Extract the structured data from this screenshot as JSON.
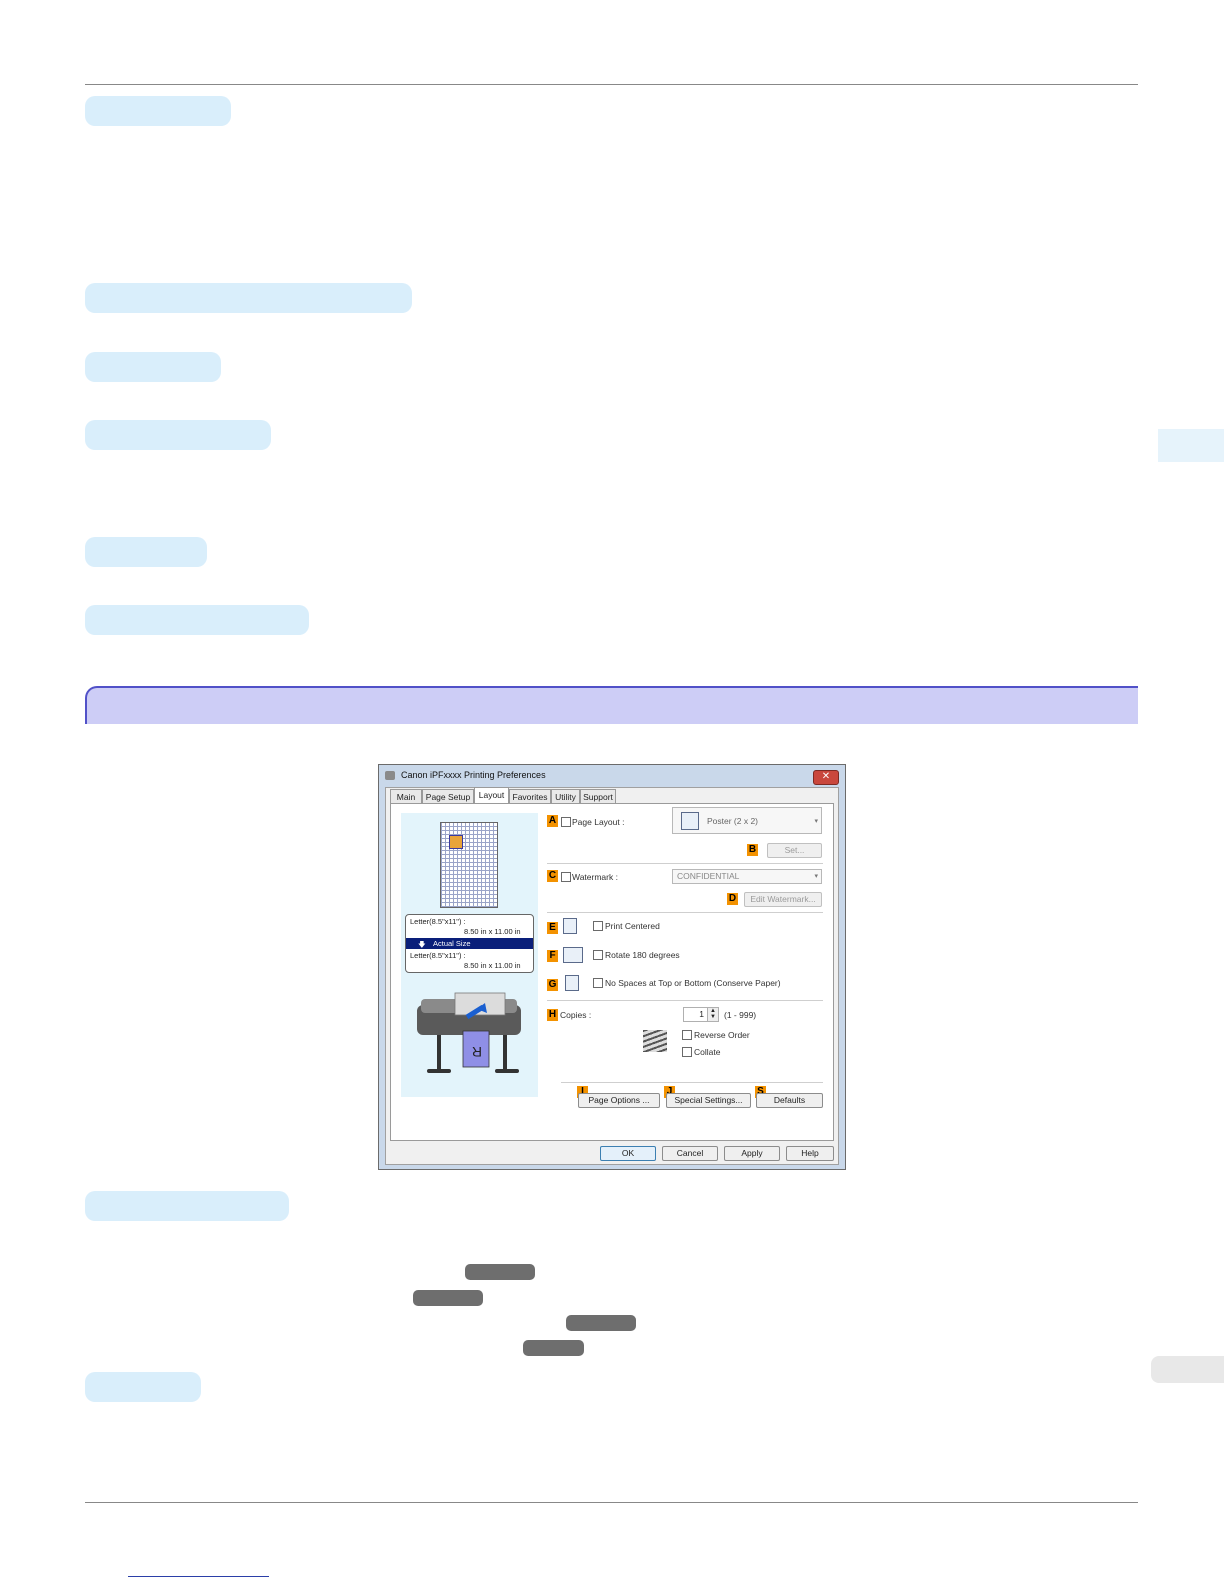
{
  "dialog": {
    "title": "Canon iPFxxxx Printing Preferences",
    "close_glyph": "✕",
    "tabs": [
      {
        "label": "Main"
      },
      {
        "label": "Page Setup"
      },
      {
        "label": "Layout"
      },
      {
        "label": "Favorites"
      },
      {
        "label": "Utility"
      },
      {
        "label": "Support"
      }
    ],
    "active_tab": "Layout",
    "preview": {
      "source_size": "Letter(8.5\"x11\") :",
      "source_dims": "8.50 in x 11.00 in",
      "mode": "Actual Size",
      "mode_arrow": "🡇",
      "output_size": "Letter(8.5\"x11\") :",
      "output_dims": "8.50 in x 11.00 in"
    },
    "labels": {
      "A": "A",
      "B": "B",
      "C": "C",
      "D": "D",
      "E": "E",
      "F": "F",
      "G": "G",
      "H": "H",
      "I": "I",
      "J": "J",
      "S": "S"
    },
    "page_layout": {
      "label": "Page Layout :",
      "value": "Poster (2 x 2)",
      "arrow": "▾"
    },
    "set_button": "Set...",
    "watermark": {
      "label": "Watermark :",
      "value": "CONFIDENTIAL",
      "arrow": "▾"
    },
    "edit_watermark_button": "Edit Watermark...",
    "print_centered": "Print Centered",
    "rotate": "Rotate 180 degrees",
    "no_spaces": "No Spaces at Top or Bottom (Conserve Paper)",
    "copies": {
      "label": "Copies :",
      "value": "1",
      "range": "(1 - 999)",
      "spin_up": "▲",
      "spin_down": "▼"
    },
    "reverse_order": "Reverse Order",
    "collate": "Collate",
    "page_options_button": "Page Options ...",
    "special_settings_button": "Special Settings...",
    "defaults_button": "Defaults",
    "ok_button": "OK",
    "cancel_button": "Cancel",
    "apply_button": "Apply",
    "help_button": "Help"
  }
}
